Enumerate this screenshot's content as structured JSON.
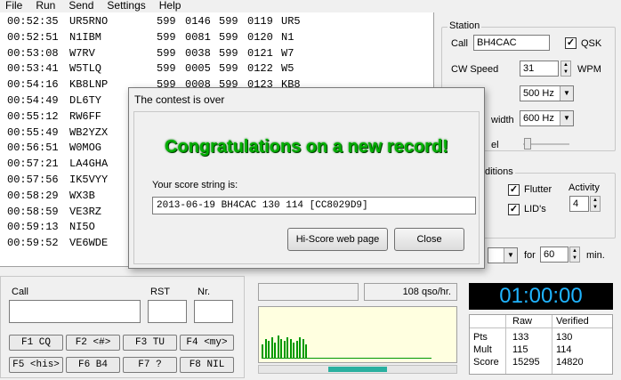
{
  "menu": [
    "File",
    "Run",
    "Send",
    "Settings",
    "Help"
  ],
  "log": [
    {
      "time": "00:52:35",
      "call": "UR5RNO",
      "rst1": "599",
      "nr1": "0146",
      "rst2": "599",
      "nr2": "0119",
      "pfx": "UR5"
    },
    {
      "time": "00:52:51",
      "call": "N1IBM",
      "rst1": "599",
      "nr1": "0081",
      "rst2": "599",
      "nr2": "0120",
      "pfx": "N1"
    },
    {
      "time": "00:53:08",
      "call": "W7RV",
      "rst1": "599",
      "nr1": "0038",
      "rst2": "599",
      "nr2": "0121",
      "pfx": "W7"
    },
    {
      "time": "00:53:41",
      "call": "W5TLQ",
      "rst1": "599",
      "nr1": "0005",
      "rst2": "599",
      "nr2": "0122",
      "pfx": "W5"
    },
    {
      "time": "00:54:16",
      "call": "KB8LNP",
      "rst1": "599",
      "nr1": "0008",
      "rst2": "599",
      "nr2": "0123",
      "pfx": "KB8"
    },
    {
      "time": "00:54:49",
      "call": "DL6TY",
      "rst1": "",
      "nr1": "",
      "rst2": "",
      "nr2": "",
      "pfx": ""
    },
    {
      "time": "00:55:12",
      "call": "RW6FF",
      "rst1": "",
      "nr1": "",
      "rst2": "",
      "nr2": "",
      "pfx": ""
    },
    {
      "time": "00:55:49",
      "call": "WB2YZX",
      "rst1": "",
      "nr1": "",
      "rst2": "",
      "nr2": "",
      "pfx": ""
    },
    {
      "time": "00:56:51",
      "call": "W0MOG",
      "rst1": "",
      "nr1": "",
      "rst2": "",
      "nr2": "",
      "pfx": ""
    },
    {
      "time": "00:57:21",
      "call": "LA4GHA",
      "rst1": "",
      "nr1": "",
      "rst2": "",
      "nr2": "",
      "pfx": ""
    },
    {
      "time": "00:57:56",
      "call": "IK5VYY",
      "rst1": "",
      "nr1": "",
      "rst2": "",
      "nr2": "",
      "pfx": ""
    },
    {
      "time": "00:58:29",
      "call": "WX3B",
      "rst1": "",
      "nr1": "",
      "rst2": "",
      "nr2": "",
      "pfx": ""
    },
    {
      "time": "00:58:59",
      "call": "VE3RZ",
      "rst1": "",
      "nr1": "",
      "rst2": "",
      "nr2": "",
      "pfx": ""
    },
    {
      "time": "00:59:13",
      "call": "NI5O",
      "rst1": "",
      "nr1": "",
      "rst2": "",
      "nr2": "",
      "pfx": ""
    },
    {
      "time": "00:59:52",
      "call": "VE6WDE",
      "rst1": "",
      "nr1": "",
      "rst2": "",
      "nr2": "",
      "pfx": ""
    }
  ],
  "station": {
    "legend": "Station",
    "call_label": "Call",
    "call_value": "BH4CAC",
    "qsk_label": "QSK",
    "qsk_checked": "✓",
    "cw_speed_label": "CW Speed",
    "cw_speed_value": "31",
    "wpm_label": "WPM",
    "pitch_value": "500 Hz",
    "bandwidth_label": "width",
    "bandwidth_value": "600 Hz",
    "monitor_label": "el"
  },
  "conditions": {
    "legend": "ditions",
    "flutter_label": "Flutter",
    "flutter_checked": "✓",
    "lids_label": "LID's",
    "lids_checked": "✓",
    "activity_label": "Activity",
    "activity_value": "4"
  },
  "run": {
    "for_label": "for",
    "minutes_value": "60",
    "min_label": "min."
  },
  "entry": {
    "call_label": "Call",
    "rst_label": "RST",
    "nr_label": "Nr."
  },
  "fkeys": [
    "F1 CQ",
    "F2 <#>",
    "F3 TU",
    "F4 <my>",
    "F5 <his>",
    "F6 B4",
    "F7 ?",
    "F8 NIL"
  ],
  "rate_text": "108 qso/hr.",
  "rate_graph": [
    8,
    11,
    10,
    12,
    9,
    13,
    11,
    10,
    12,
    11,
    9,
    10,
    12,
    11,
    8
  ],
  "clock": "01:00:00",
  "score": {
    "headers": [
      "Raw",
      "Verified"
    ],
    "rows": [
      {
        "label": "Pts",
        "raw": "133",
        "verified": "130"
      },
      {
        "label": "Mult",
        "raw": "115",
        "verified": "114"
      },
      {
        "label": "Score",
        "raw": "15295",
        "verified": "14820"
      }
    ]
  },
  "dialog": {
    "title": "The contest is over",
    "headline": "Congratulations on a new record!",
    "score_label": "Your score string is:",
    "score_string": "2013-06-19 BH4CAC 130 114 [CC8029D9]",
    "hiscore_button": "Hi-Score web page",
    "close_button": "Close"
  },
  "colors": {
    "headline": "#00b000",
    "clock_bg": "#000000",
    "clock_fg": "#1fb4ff",
    "graph_bg": "#ffffe0",
    "graph_bar": "#009900",
    "scroll_thumb": "#2ab0a0"
  }
}
